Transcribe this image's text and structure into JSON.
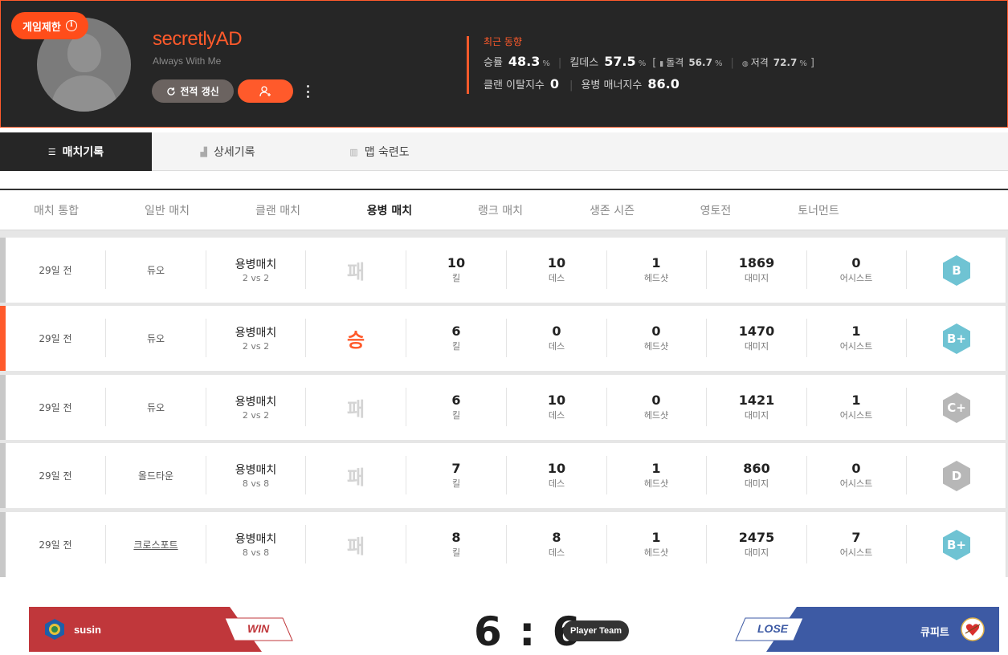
{
  "profile": {
    "restriction_badge": "게임제한",
    "nickname": "secretlyAD",
    "subtitle": "Always With Me",
    "refresh_label": "전적 갱신",
    "accent_color": "#ff5a2b"
  },
  "recent": {
    "title": "최근 동향",
    "winrate_label": "승률",
    "winrate_value": "48.3",
    "kd_label": "킬데스",
    "kd_value": "57.5",
    "assault_label": "돌격",
    "assault_value": "56.7",
    "sniper_label": "저격",
    "sniper_value": "72.7",
    "percent": "%",
    "bracket_open": "[",
    "bracket_close": "]",
    "clan_leave_label": "클랜 이탈지수",
    "clan_leave_value": "0",
    "manner_label": "용병 매너지수",
    "manner_value": "86.0"
  },
  "tabs": [
    {
      "label": "매치기록",
      "icon": "list-icon",
      "active": true
    },
    {
      "label": "상세기록",
      "icon": "chart-icon",
      "active": false
    },
    {
      "label": "맵 숙련도",
      "icon": "map-icon",
      "active": false
    }
  ],
  "subtabs": [
    "매치 통합",
    "일반 매치",
    "클랜 매치",
    "용병 매치",
    "랭크 매치",
    "생존 시즌",
    "영토전",
    "토너먼트"
  ],
  "active_subtab": "용병 매치",
  "stat_labels": {
    "kill": "킬",
    "death": "데스",
    "headshot": "헤드샷",
    "damage": "대미지",
    "assist": "어시스트"
  },
  "matches": [
    {
      "time": "29일 전",
      "mode": "듀오",
      "type": "용병매치",
      "size": "2 vs 2",
      "result": "패",
      "kill": "10",
      "death": "10",
      "headshot": "1",
      "damage": "1869",
      "assist": "0",
      "grade": "B",
      "grade_color": "#6fc3d3"
    },
    {
      "time": "29일 전",
      "mode": "듀오",
      "type": "용병매치",
      "size": "2 vs 2",
      "result": "승",
      "kill": "6",
      "death": "0",
      "headshot": "0",
      "damage": "1470",
      "assist": "1",
      "grade": "B+",
      "grade_color": "#6fc3d3"
    },
    {
      "time": "29일 전",
      "mode": "듀오",
      "type": "용병매치",
      "size": "2 vs 2",
      "result": "패",
      "kill": "6",
      "death": "10",
      "headshot": "0",
      "damage": "1421",
      "assist": "1",
      "grade": "C+",
      "grade_color": "#b7b7b7"
    },
    {
      "time": "29일 전",
      "mode": "올드타운",
      "type": "용병매치",
      "size": "8 vs 8",
      "result": "패",
      "kill": "7",
      "death": "10",
      "headshot": "1",
      "damage": "860",
      "assist": "0",
      "grade": "D",
      "grade_color": "#b7b7b7"
    },
    {
      "time": "29일 전",
      "mode": "크로스포트",
      "type": "용병매치",
      "size": "8 vs 8",
      "result": "패",
      "kill": "8",
      "death": "8",
      "headshot": "1",
      "damage": "2475",
      "assist": "7",
      "grade": "B+",
      "grade_color": "#6fc3d3"
    }
  ],
  "scoreboard": {
    "left_team": "susin",
    "left_flag": "WIN",
    "left_color": "#c0373b",
    "score": "6 : 6",
    "player_team_label": "Player Team",
    "right_flag": "LOSE",
    "right_team": "큐피트",
    "right_color": "#3d5aa4"
  }
}
